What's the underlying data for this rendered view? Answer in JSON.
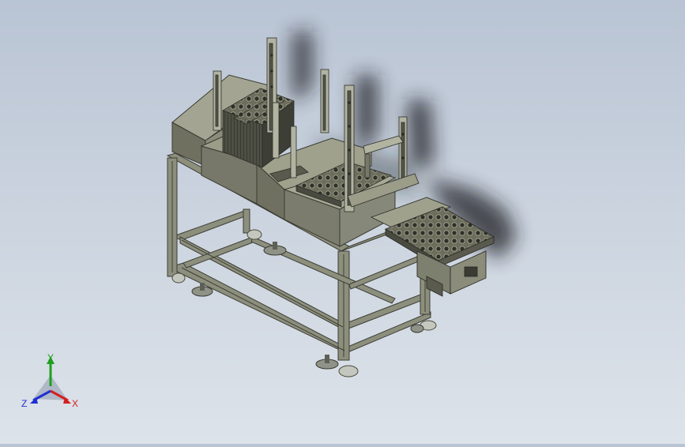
{
  "viewport": {
    "background_top": "#b9c4d4",
    "background_bottom": "#dde3ea",
    "model_color": "#6f705f",
    "model_dark": "#4a4b40",
    "model_light": "#a3a592",
    "shadow_color": "#1a1d22"
  },
  "triad": {
    "x_label": "X",
    "y_label": "Y",
    "z_label": "Z",
    "x_color": "#d42020",
    "y_color": "#1ea01e",
    "z_color": "#2030d0"
  }
}
